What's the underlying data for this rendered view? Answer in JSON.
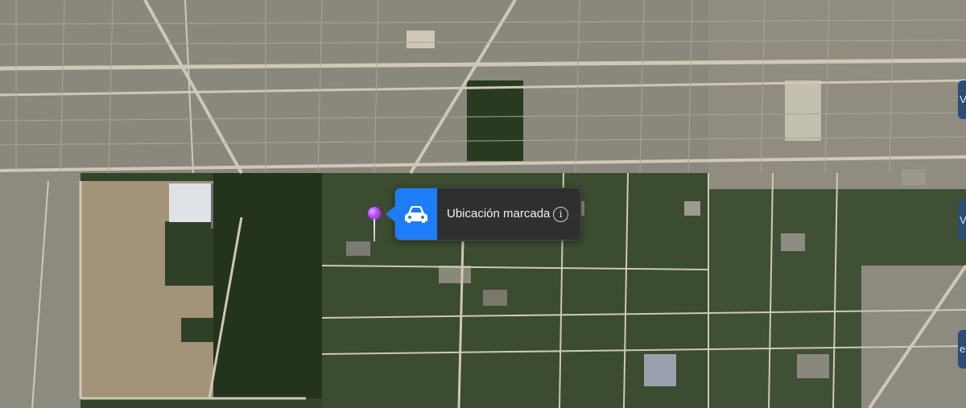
{
  "map": {
    "view": "satellite",
    "colors": {
      "urban": "#8c8a80",
      "forest": "#2d3d24",
      "road": "#c9c2b0",
      "clearing": "#9e8f72"
    }
  },
  "pin": {
    "icon": "pin-icon",
    "color": "#b14ee6"
  },
  "callout": {
    "icon": "car-icon",
    "accent": "#1e7df6",
    "label": "Ubicación marcada",
    "info_icon": "info-icon",
    "info_glyph": "i"
  },
  "edge_tabs": [
    {
      "text": "V"
    },
    {
      "text": "V"
    },
    {
      "text": "e"
    }
  ]
}
